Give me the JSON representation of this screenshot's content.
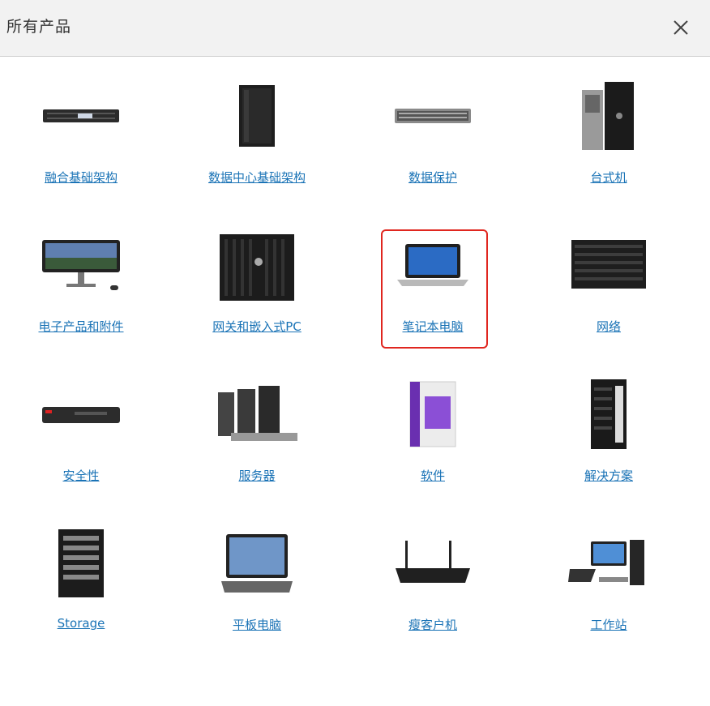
{
  "header": {
    "title": "所有产品"
  },
  "products": [
    {
      "label": "融合基础架构",
      "icon": "vxrail-appliance-icon"
    },
    {
      "label": "数据中心基础架构",
      "icon": "server-rack-icon"
    },
    {
      "label": "数据保护",
      "icon": "rack-server-icon"
    },
    {
      "label": "台式机",
      "icon": "desktop-tower-icon"
    },
    {
      "label": "电子产品和附件",
      "icon": "monitor-icon"
    },
    {
      "label": "网关和嵌入式PC",
      "icon": "gateway-box-icon"
    },
    {
      "label": "笔记本电脑",
      "icon": "laptop-icon"
    },
    {
      "label": "网络",
      "icon": "network-switch-icon"
    },
    {
      "label": "安全性",
      "icon": "firewall-appliance-icon"
    },
    {
      "label": "服务器",
      "icon": "servers-icon"
    },
    {
      "label": "软件",
      "icon": "software-box-icon"
    },
    {
      "label": "解决方案",
      "icon": "vxblock-rack-icon"
    },
    {
      "label": "Storage",
      "icon": "storage-array-icon"
    },
    {
      "label": "平板电脑",
      "icon": "tablet-icon"
    },
    {
      "label": "瘦客户机",
      "icon": "thin-client-icon"
    },
    {
      "label": "工作站",
      "icon": "workstation-icon"
    }
  ],
  "highlighted_item": "笔记本电脑"
}
